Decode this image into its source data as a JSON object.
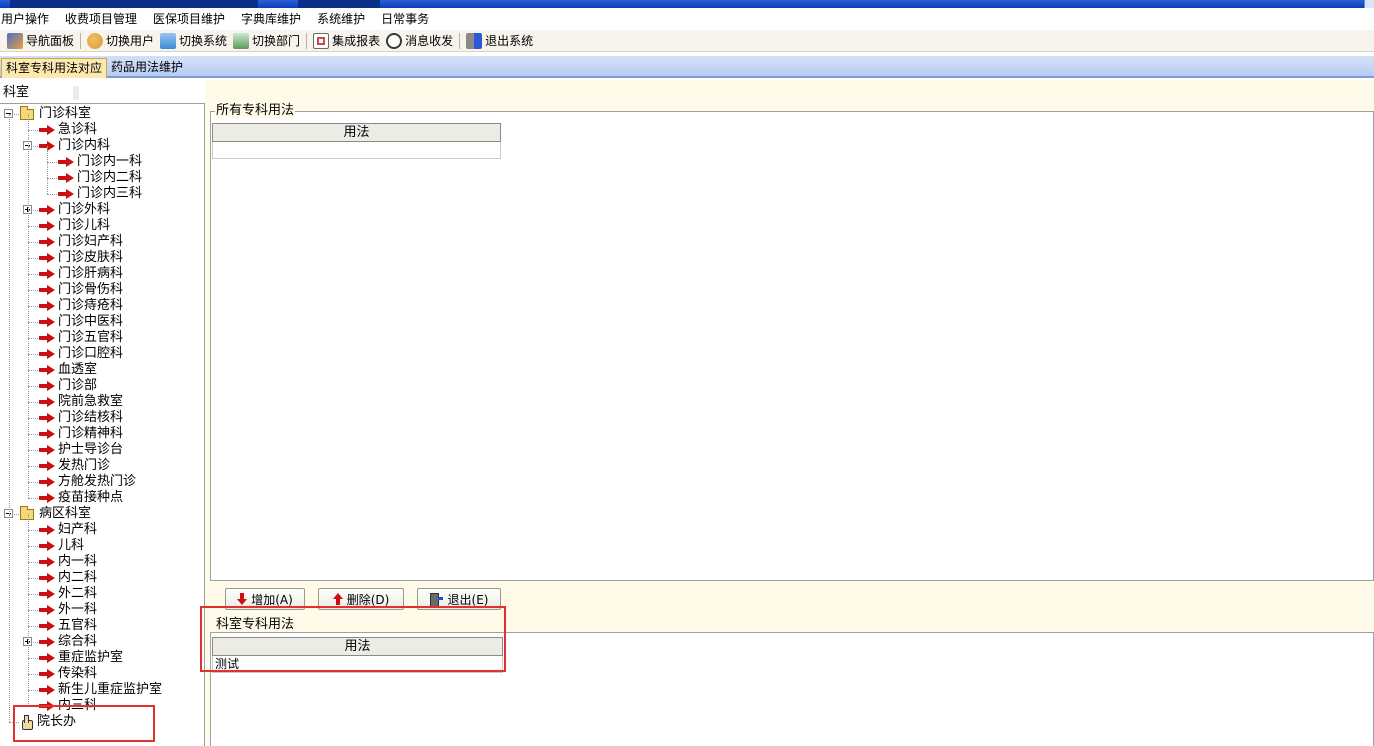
{
  "menu": [
    "用户操作",
    "收费项目管理",
    "医保项目维护",
    "字典库维护",
    "系统维护",
    "日常事务"
  ],
  "toolbar": [
    {
      "label": "导航面板",
      "icon": "navigation-panel-icon",
      "color": "#4a6fc8"
    },
    {
      "label": "切换用户",
      "icon": "switch-user-icon",
      "color": "#d89a3a"
    },
    {
      "label": "切换系统",
      "icon": "switch-system-icon",
      "color": "#3a8ad8"
    },
    {
      "label": "切换部门",
      "icon": "switch-department-icon",
      "color": "#5a9a5a"
    },
    {
      "label": "集成报表",
      "icon": "report-icon",
      "color": "#c84a4a"
    },
    {
      "label": "消息收发",
      "icon": "message-icon",
      "color": "#3a6ac8"
    },
    {
      "label": "退出系统",
      "icon": "exit-system-icon",
      "color": "#2a5ad8"
    }
  ],
  "tabs": [
    "科室专科用法对应",
    "药品用法维护"
  ],
  "tree": {
    "header": "科室",
    "nodes": [
      {
        "label": "门诊科室",
        "level": 0,
        "type": "folder",
        "expander": "minus"
      },
      {
        "label": "急诊科",
        "level": 1,
        "type": "arrow"
      },
      {
        "label": "门诊内科",
        "level": 1,
        "type": "arrow",
        "expander": "minus"
      },
      {
        "label": "门诊内一科",
        "level": 2,
        "type": "arrow"
      },
      {
        "label": "门诊内二科",
        "level": 2,
        "type": "arrow"
      },
      {
        "label": "门诊内三科",
        "level": 2,
        "type": "arrow"
      },
      {
        "label": "门诊外科",
        "level": 1,
        "type": "arrow",
        "expander": "plus"
      },
      {
        "label": "门诊儿科",
        "level": 1,
        "type": "arrow"
      },
      {
        "label": "门诊妇产科",
        "level": 1,
        "type": "arrow"
      },
      {
        "label": "门诊皮肤科",
        "level": 1,
        "type": "arrow"
      },
      {
        "label": "门诊肝病科",
        "level": 1,
        "type": "arrow"
      },
      {
        "label": "门诊骨伤科",
        "level": 1,
        "type": "arrow"
      },
      {
        "label": "门诊痔疮科",
        "level": 1,
        "type": "arrow"
      },
      {
        "label": "门诊中医科",
        "level": 1,
        "type": "arrow"
      },
      {
        "label": "门诊五官科",
        "level": 1,
        "type": "arrow"
      },
      {
        "label": "门诊口腔科",
        "level": 1,
        "type": "arrow"
      },
      {
        "label": "血透室",
        "level": 1,
        "type": "arrow"
      },
      {
        "label": "门诊部",
        "level": 1,
        "type": "arrow"
      },
      {
        "label": "院前急救室",
        "level": 1,
        "type": "arrow"
      },
      {
        "label": "门诊结核科",
        "level": 1,
        "type": "arrow"
      },
      {
        "label": "门诊精神科",
        "level": 1,
        "type": "arrow"
      },
      {
        "label": "护士导诊台",
        "level": 1,
        "type": "arrow"
      },
      {
        "label": "发热门诊",
        "level": 1,
        "type": "arrow"
      },
      {
        "label": "方舱发热门诊",
        "level": 1,
        "type": "arrow"
      },
      {
        "label": "疫苗接种点",
        "level": 1,
        "type": "arrow"
      },
      {
        "label": "病区科室",
        "level": 0,
        "type": "folder",
        "expander": "minus"
      },
      {
        "label": "妇产科",
        "level": 1,
        "type": "arrow"
      },
      {
        "label": "儿科",
        "level": 1,
        "type": "arrow"
      },
      {
        "label": "内一科",
        "level": 1,
        "type": "arrow"
      },
      {
        "label": "内二科",
        "level": 1,
        "type": "arrow"
      },
      {
        "label": "外二科",
        "level": 1,
        "type": "arrow"
      },
      {
        "label": "外一科",
        "level": 1,
        "type": "arrow"
      },
      {
        "label": "五官科",
        "level": 1,
        "type": "arrow"
      },
      {
        "label": "综合科",
        "level": 1,
        "type": "arrow",
        "expander": "plus"
      },
      {
        "label": "重症监护室",
        "level": 1,
        "type": "arrow"
      },
      {
        "label": "传染科",
        "level": 1,
        "type": "arrow"
      },
      {
        "label": "新生儿重症监护室",
        "level": 1,
        "type": "arrow"
      },
      {
        "label": "内三科",
        "level": 1,
        "type": "arrow"
      },
      {
        "label": "院长办",
        "level": 0,
        "type": "hand"
      }
    ]
  },
  "all_usage": {
    "title": "所有专科用法",
    "column": "用法",
    "rows": [
      ""
    ]
  },
  "buttons": {
    "add": "增加(A)",
    "delete": "删除(D)",
    "exit": "退出(E)"
  },
  "dept_usage": {
    "title": "科室专科用法",
    "column": "用法",
    "rows": [
      "测试"
    ]
  },
  "colors": {
    "highlight": "#e03030",
    "panel_bg": "#fffbe8",
    "arrow": "#cc1010"
  }
}
